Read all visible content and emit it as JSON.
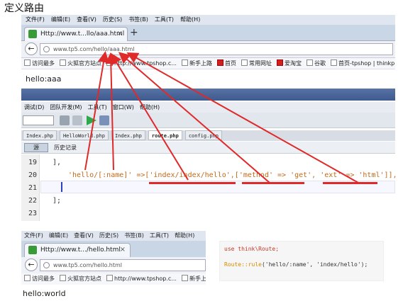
{
  "page_title": "定义路由",
  "browser1": {
    "menu": [
      "文件(F)",
      "编辑(E)",
      "查看(V)",
      "历史(S)",
      "书签(B)",
      "工具(T)",
      "帮助(H)"
    ],
    "tab_title": "Http://www.t...llo/aaa.html",
    "tab_close": "×",
    "new_tab": "+",
    "url_text": "www.tp5.com/hello/aaa.html",
    "bookmarks": [
      "访问最多",
      "火狐官方站点",
      "http://www.tpshop.c...",
      "新手上路",
      "首页",
      "常用网址",
      "爱淘宝",
      "谷歌",
      "首页-tpshop | thinkp..."
    ],
    "page_text": "hello:aaa"
  },
  "ide": {
    "menu": [
      "调试(D)",
      "团队开发(M)",
      "工具(T)",
      "窗口(W)",
      "帮助(H)"
    ],
    "file_tabs": [
      "Index.php",
      "HelloWorld.php",
      "Index.php",
      "route.php",
      "config.php"
    ],
    "active_tab": "route.php",
    "source_button": "源",
    "history_button": "历史记录",
    "lines": [
      {
        "num": "19",
        "code": "],"
      },
      {
        "num": "20",
        "code": "'hello/[:name]' =>['index/index/hello',['method' => 'get', 'ext' => 'html']],"
      },
      {
        "num": "21",
        "code": ""
      },
      {
        "num": "22",
        "code": "];"
      }
    ]
  },
  "browser2": {
    "menu": [
      "文件(F)",
      "编辑(E)",
      "查看(V)",
      "历史(S)",
      "书签(B)",
      "工具(T)",
      "帮助(H)"
    ],
    "tab_title": "Http://www.t.../hello.html",
    "tab_close": "×",
    "url_text": "www.tp5.com/hello.html",
    "bookmarks": [
      "访问最多",
      "火狐官方站点",
      "http://www.tpshop.c...",
      "新手上路"
    ],
    "page_text": "hello:world"
  },
  "snippet": {
    "line1": "use think\\Route;",
    "line2_fn": "Route::rule",
    "line2_rest": "('hello/:name', 'index/hello');"
  },
  "colors": {
    "annotation_red": "#e02a2a",
    "string_orange": "#c06a1a",
    "caret_blue": "#2a40c8"
  }
}
